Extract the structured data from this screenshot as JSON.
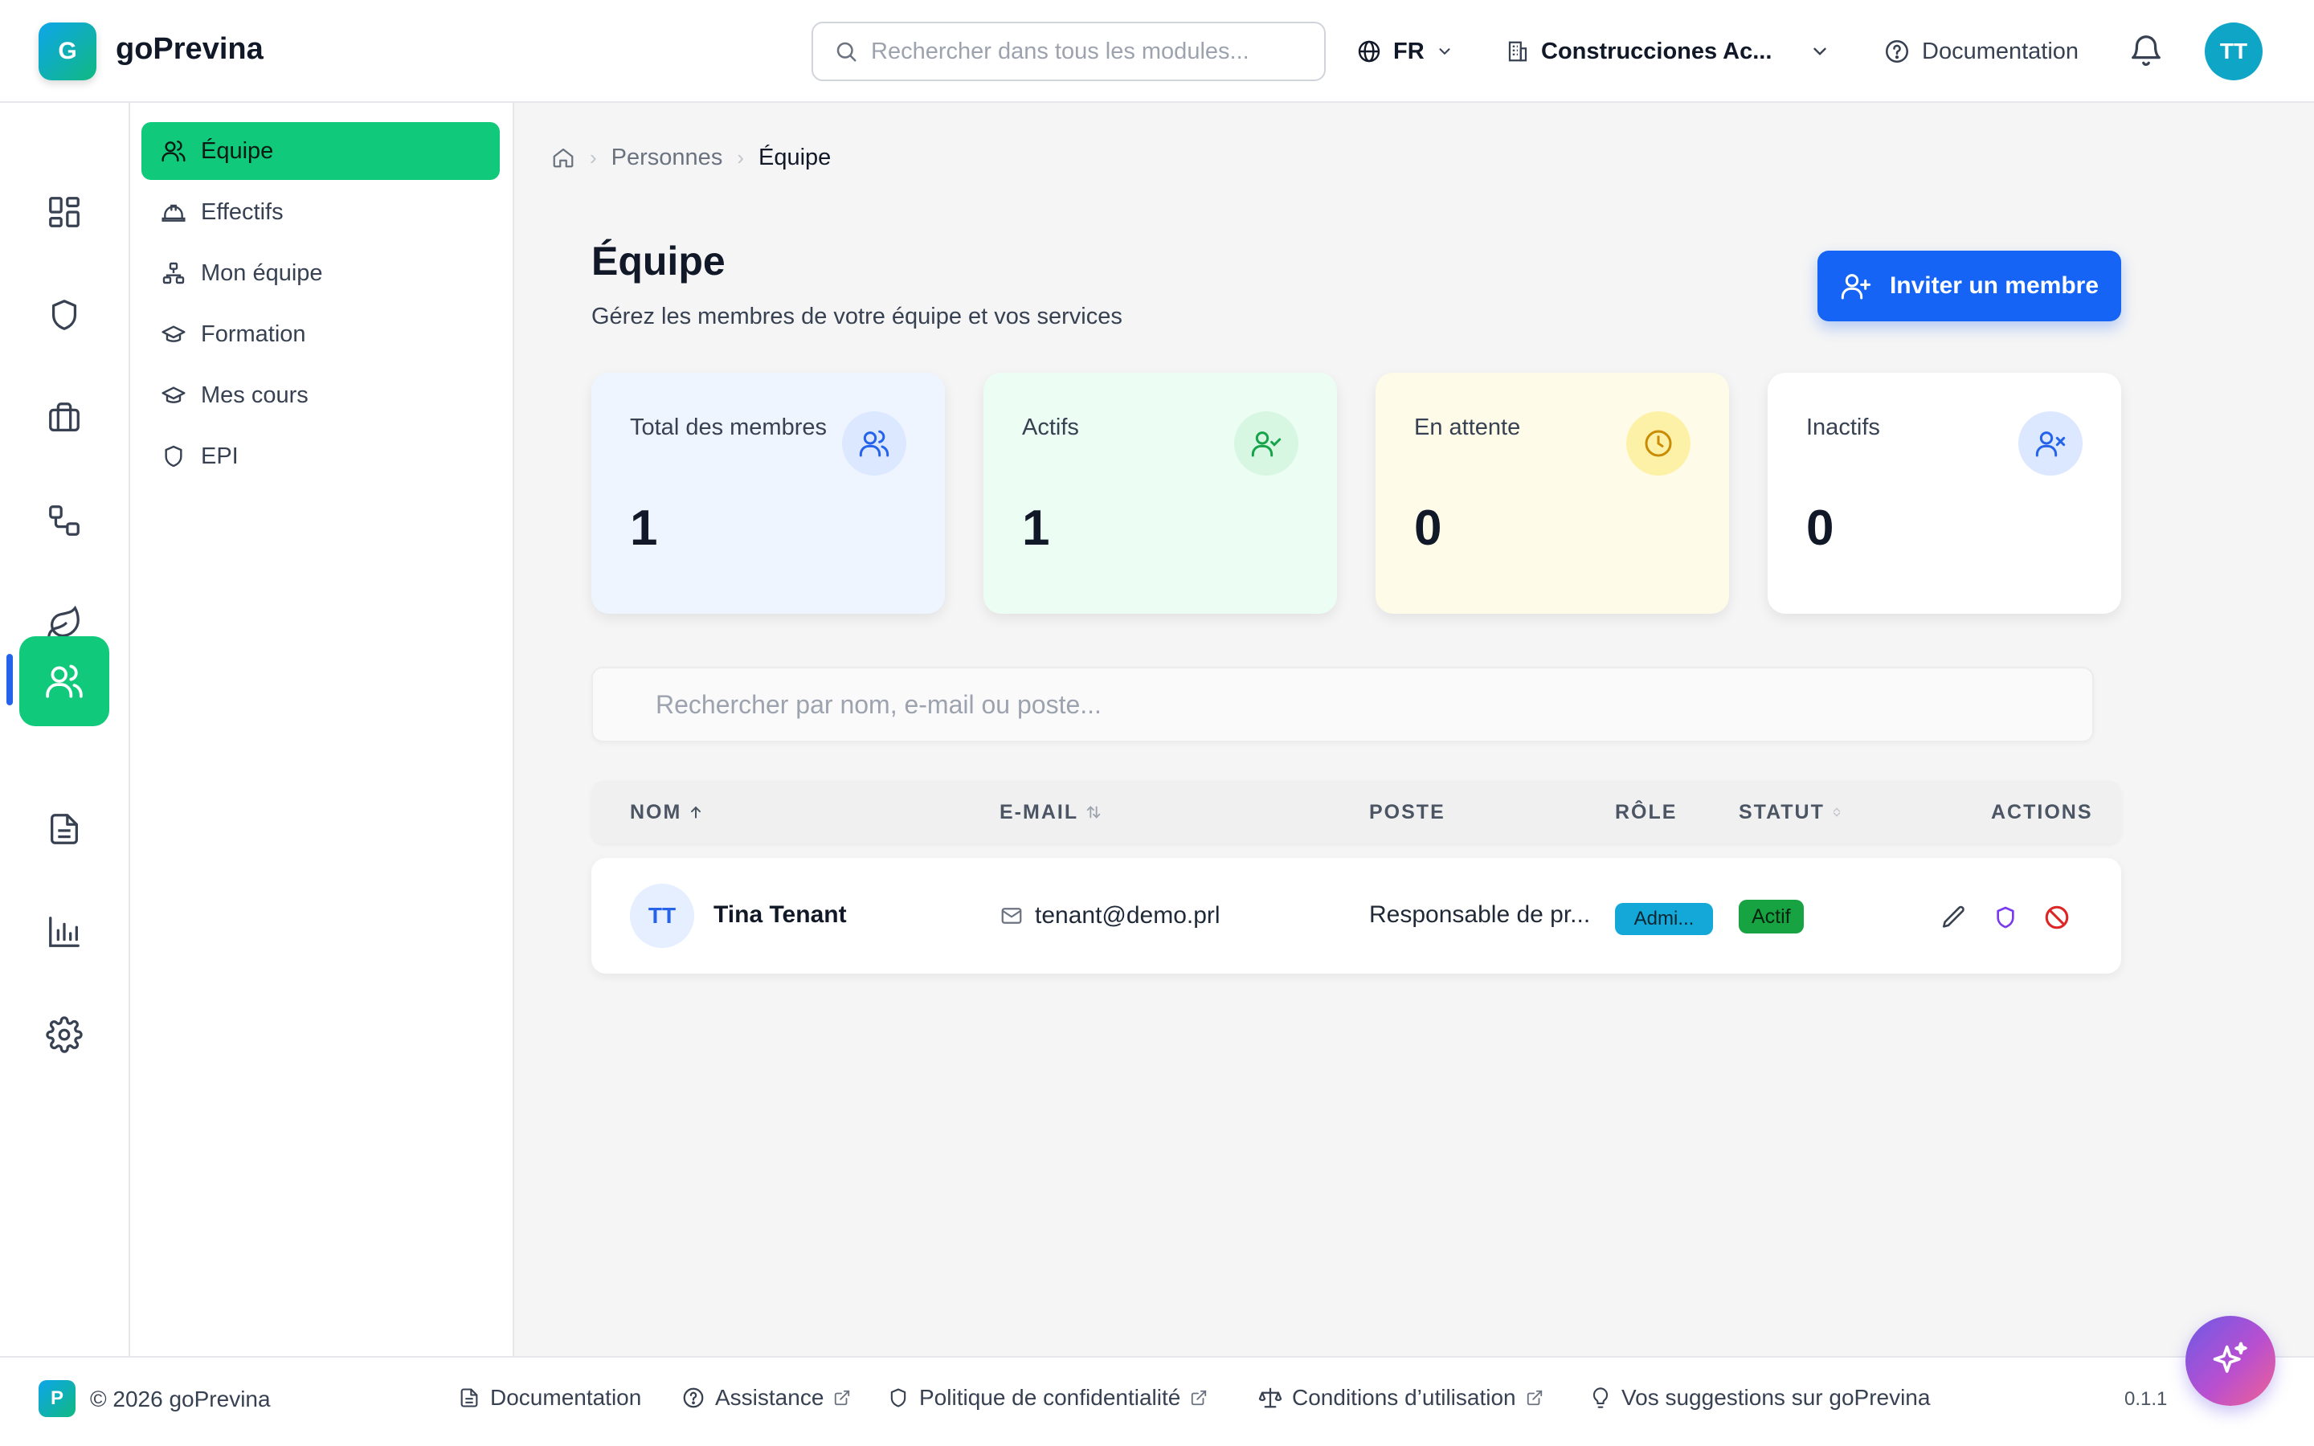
{
  "header": {
    "logo_letter": "G",
    "brand": "goPrevina",
    "search_placeholder": "Rechercher dans tous les modules...",
    "language": "FR",
    "company": "Construcciones Ac...",
    "documentation": "Documentation",
    "avatar_initials": "TT"
  },
  "rail": {
    "items": [
      {
        "icon": "dashboard-icon"
      },
      {
        "icon": "shield-icon"
      },
      {
        "icon": "briefcase-icon"
      },
      {
        "icon": "workflow-icon"
      },
      {
        "icon": "leaf-icon"
      },
      {
        "icon": "users-icon",
        "active": true
      },
      {
        "icon": "document-icon"
      },
      {
        "icon": "chart-icon"
      },
      {
        "icon": "gear-icon"
      }
    ]
  },
  "submenu": {
    "items": [
      {
        "label": "Équipe",
        "icon": "users-icon",
        "active": true
      },
      {
        "label": "Effectifs",
        "icon": "hard-hat-icon"
      },
      {
        "label": "Mon équipe",
        "icon": "org-chart-icon"
      },
      {
        "label": "Formation",
        "icon": "graduation-cap-icon"
      },
      {
        "label": "Mes cours",
        "icon": "graduation-cap-icon"
      },
      {
        "label": "EPI",
        "icon": "shield-icon"
      }
    ]
  },
  "breadcrumb": {
    "items": [
      "Personnes",
      "Équipe"
    ]
  },
  "page": {
    "title": "Équipe",
    "subtitle": "Gérez les membres de votre équipe et vos services",
    "invite_label": "Inviter un membre"
  },
  "stats": [
    {
      "label": "Total des membres",
      "value": "1",
      "bg": "#eef5ff",
      "icon_bg": "#dbe8ff",
      "icon_color": "#2563eb",
      "icon": "users-icon"
    },
    {
      "label": "Actifs",
      "value": "1",
      "bg": "#ecfdf3",
      "icon_bg": "#d7f7e3",
      "icon_color": "#16a34a",
      "icon": "user-check-icon"
    },
    {
      "label": "En attente",
      "value": "0",
      "bg": "#fefce8",
      "icon_bg": "#fdf1a8",
      "icon_color": "#ca8a04",
      "icon": "clock-icon"
    },
    {
      "label": "Inactifs",
      "value": "0",
      "bg": "#ffffff",
      "icon_bg": "#dbe8ff",
      "icon_color": "#2563eb",
      "icon": "user-x-icon"
    }
  ],
  "member_search_placeholder": "Rechercher par nom, e-mail ou poste...",
  "table": {
    "headers": {
      "name": "NOM",
      "email": "E-MAIL",
      "poste": "POSTE",
      "role": "RÔLE",
      "status": "STATUT",
      "actions": "ACTIONS"
    },
    "rows": [
      {
        "initials": "TT",
        "name": "Tina Tenant",
        "email": "tenant@demo.prl",
        "poste": "Responsable de pr...",
        "role": "Admi...",
        "status": "Actif"
      }
    ]
  },
  "footer": {
    "logo_letter": "P",
    "copyright": "© 2026 goPrevina",
    "links": [
      {
        "label": "Documentation",
        "external": false
      },
      {
        "label": "Assistance",
        "external": true
      },
      {
        "label": "Politique de confidentialité",
        "external": true
      },
      {
        "label": "Conditions d’utilisation",
        "external": true
      },
      {
        "label": "Vos suggestions sur goPrevina",
        "external": false
      }
    ],
    "version": "0.1.1"
  },
  "colors": {
    "primary_green": "#10c97a",
    "primary_blue": "#1664f5",
    "role_badge": "#13a8d8",
    "status_active": "#18a342"
  }
}
